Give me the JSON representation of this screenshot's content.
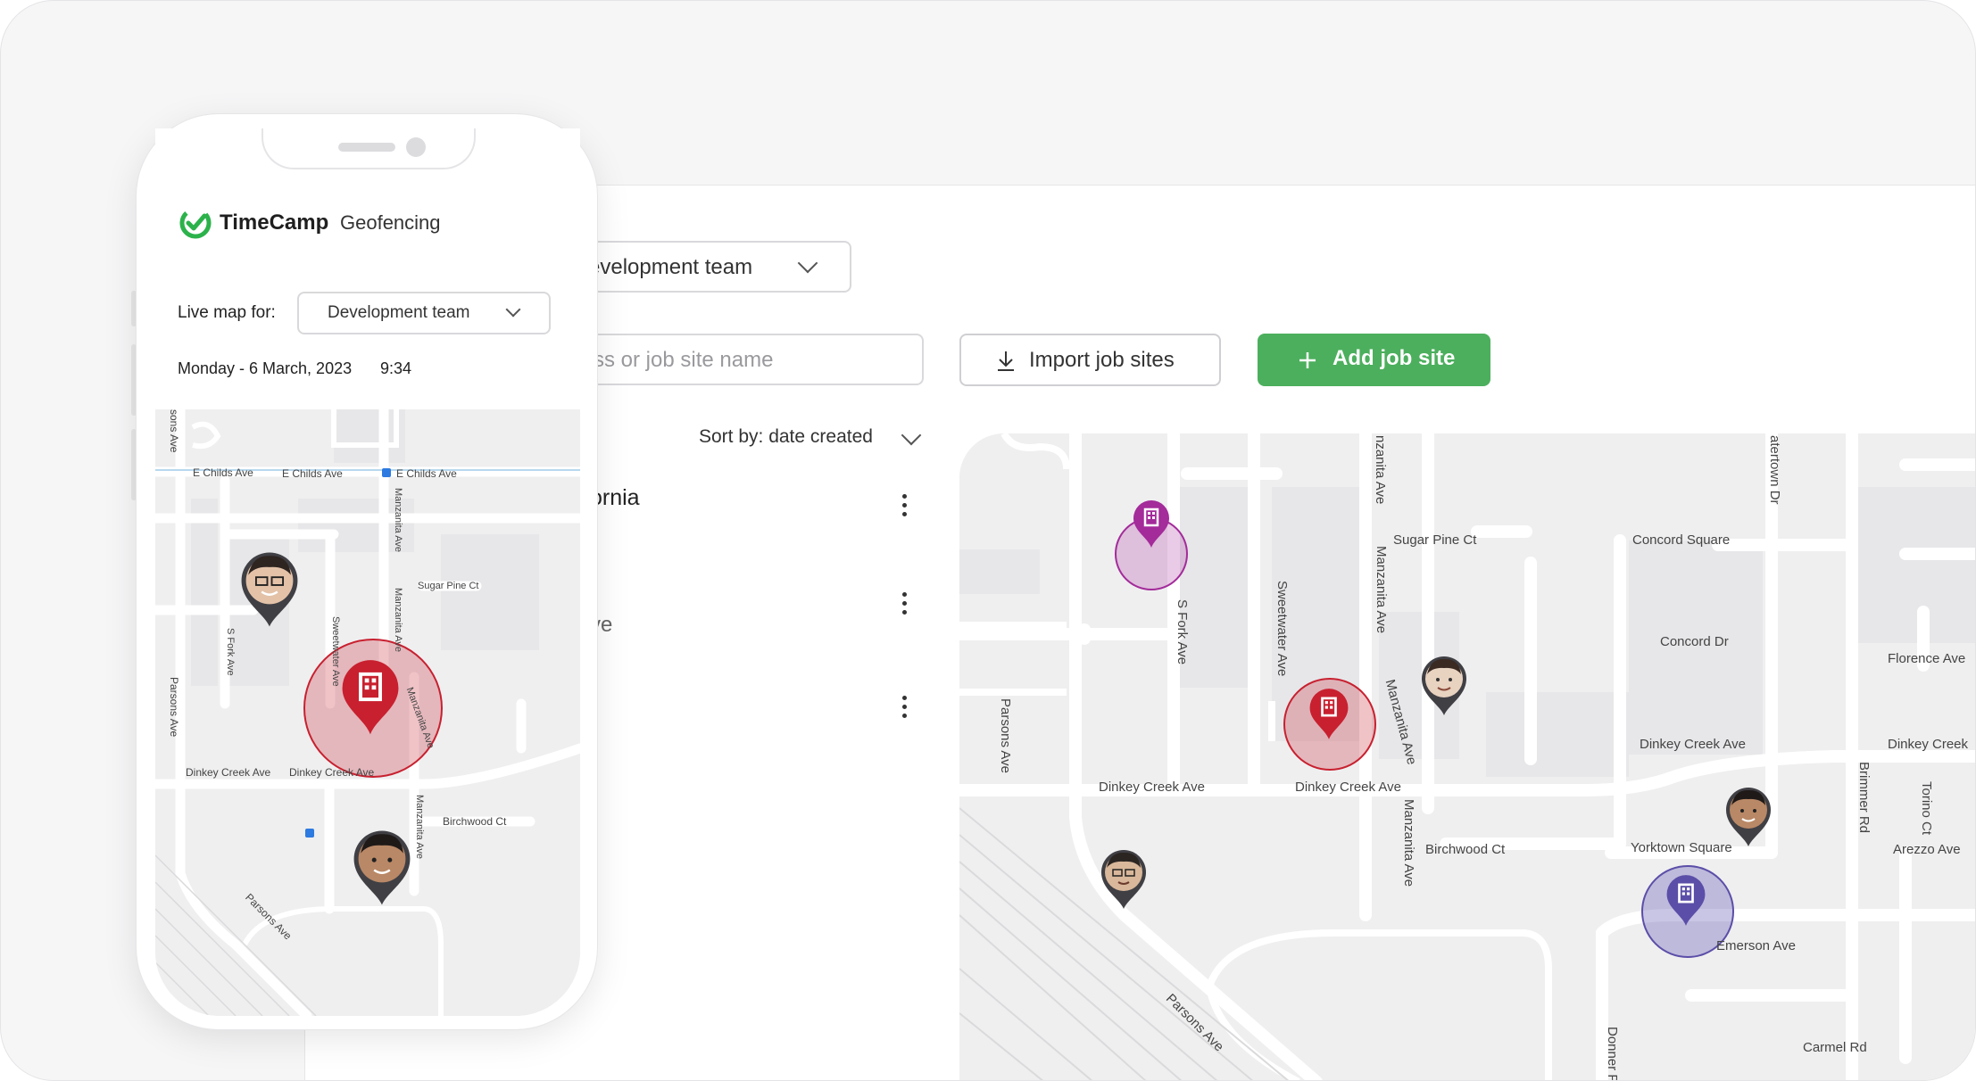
{
  "desktop": {
    "team_dropdown": {
      "label": "evelopment team"
    },
    "search": {
      "placeholder": "ss or job site name"
    },
    "import_button": {
      "label": "Import job sites"
    },
    "add_button": {
      "label": "Add job site"
    },
    "sort": {
      "label": "Sort by: date created"
    },
    "list": [
      {
        "text": "ornia"
      },
      {
        "text": ""
      },
      {
        "text": "ve"
      }
    ],
    "map_labels": {
      "sugar_pine": "Sugar Pine Ct",
      "concord_square": "Concord Square",
      "concord_dr": "Concord Dr",
      "florence": "Florence Ave",
      "dinkey_creek_1": "Dinkey Creek Ave",
      "dinkey_creek_2": "Dinkey Creek Ave",
      "dinkey_creek_3": "Dinkey Creek Ave",
      "dinkey_creek_4": "Dinkey Creek",
      "birchwood": "Birchwood Ct",
      "yorktown": "Yorktown Square",
      "arezzo": "Arezzo Ave",
      "emerson": "Emerson Ave",
      "carmel": "Carmel Rd",
      "parsons_v": "Parsons Ave",
      "parsons_diag": "Parsons Ave",
      "s_fork": "S Fork Ave",
      "sweetwater": "Sweetwater Ave",
      "manzanita_1": "nzanita Ave",
      "manzanita_2": "Manzanita Ave",
      "manzanita_3": "Manzanita Ave",
      "manzanita_4": "Manzanita Ave",
      "watertown": "atertown Dr",
      "brimmer": "Brimmer Rd",
      "torino": "Torino Ct",
      "donner": "Donner P"
    }
  },
  "phone": {
    "brand": "TimeCamp",
    "brand_sub": "Geofencing",
    "live_map_label": "Live map for:",
    "team_dropdown": "Development team",
    "date": "Monday - 6 March, 2023",
    "time": "9:34",
    "map_labels": {
      "childs_1": "E Childs Ave",
      "childs_2": "E Childs Ave",
      "childs_3": "E Childs Ave",
      "sons": "sons Ave",
      "manzanita_1": "Manzanita Ave",
      "manzanita_2": "Manzanita Ave",
      "manzanita_3": "Manzanita Ave",
      "manzanita_4": "Manzanita Ave",
      "sugar_pine": "Sugar Pine Ct",
      "s_fork": "S Fork Ave",
      "sweetwater": "Sweetwater Ave",
      "parsons_v": "Parsons Ave",
      "dinkey_1": "Dinkey Creek Ave",
      "dinkey_2": "Dinkey Creek Ave",
      "birchwood": "Birchwood Ct",
      "parsons_diag": "Parsons Ave"
    }
  },
  "colors": {
    "accent_green": "#4caf5d",
    "geofence_red": "#c8202f",
    "geofence_purple": "#a32b9a",
    "geofence_violet": "#5b4ea8",
    "pin_dark": "#3f3f44"
  }
}
